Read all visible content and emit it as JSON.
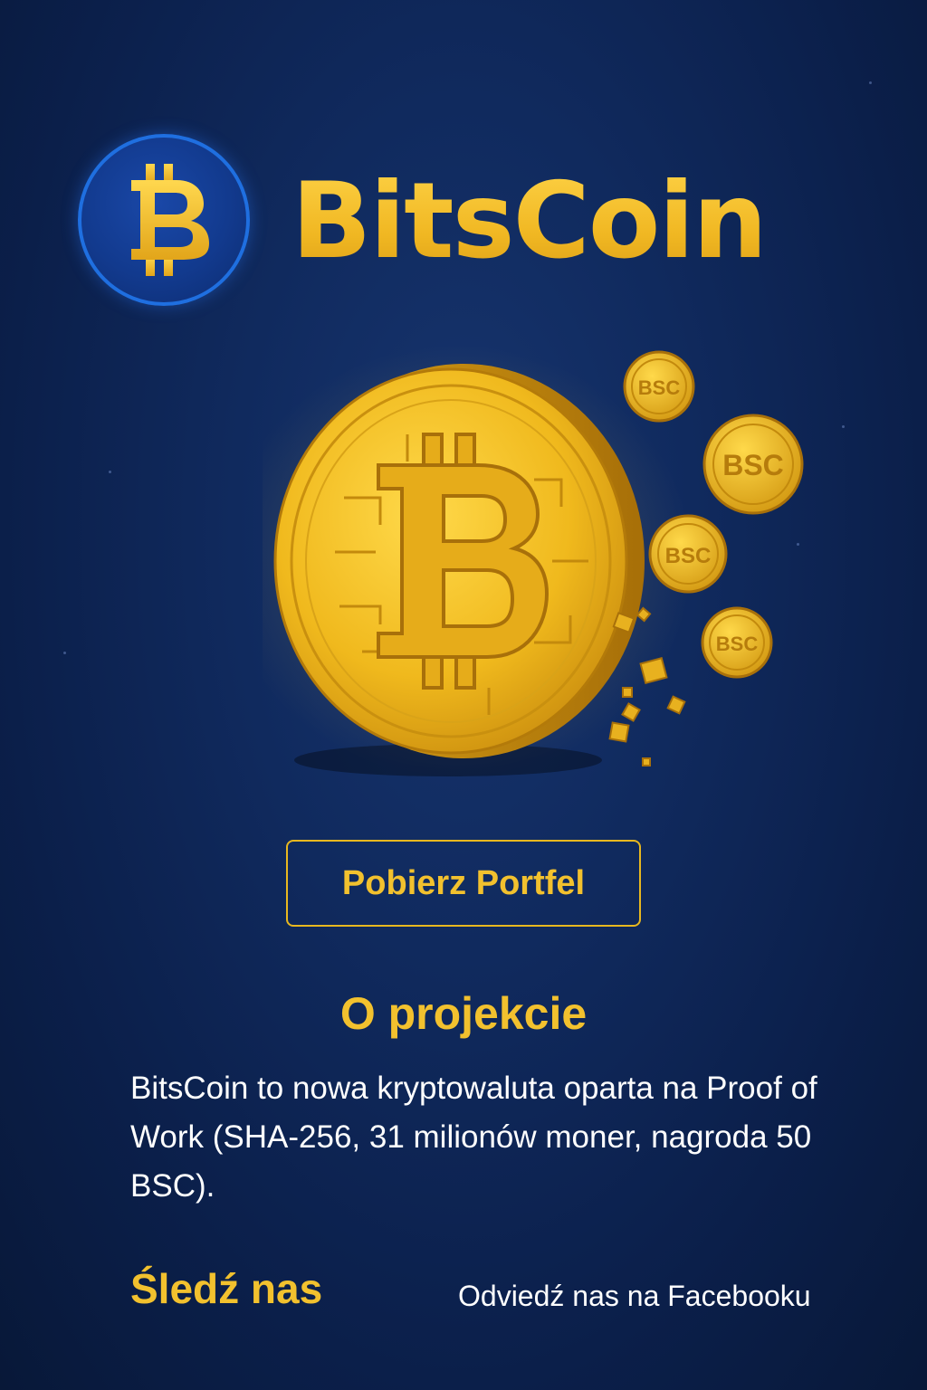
{
  "brand": {
    "name": "BitsCoin",
    "logo_symbol": "bitcoin-b",
    "accent_color": "#f2c12e",
    "background_color": "#0b1f4a"
  },
  "hero": {
    "coin_icon": "bitcoin-coin",
    "small_coin_label": "BSC"
  },
  "cta": {
    "label": "Pobierz Portfel"
  },
  "about": {
    "title": "O projekcie",
    "text": "BitsCoin to nowa kryptowaluta oparta na Proof of Work (SHA-256, 31 milionów moner, nagroda 50 BSC)."
  },
  "follow": {
    "title": "Śledź nas",
    "facebook_link": "Odviedź nas na Facebooku"
  }
}
